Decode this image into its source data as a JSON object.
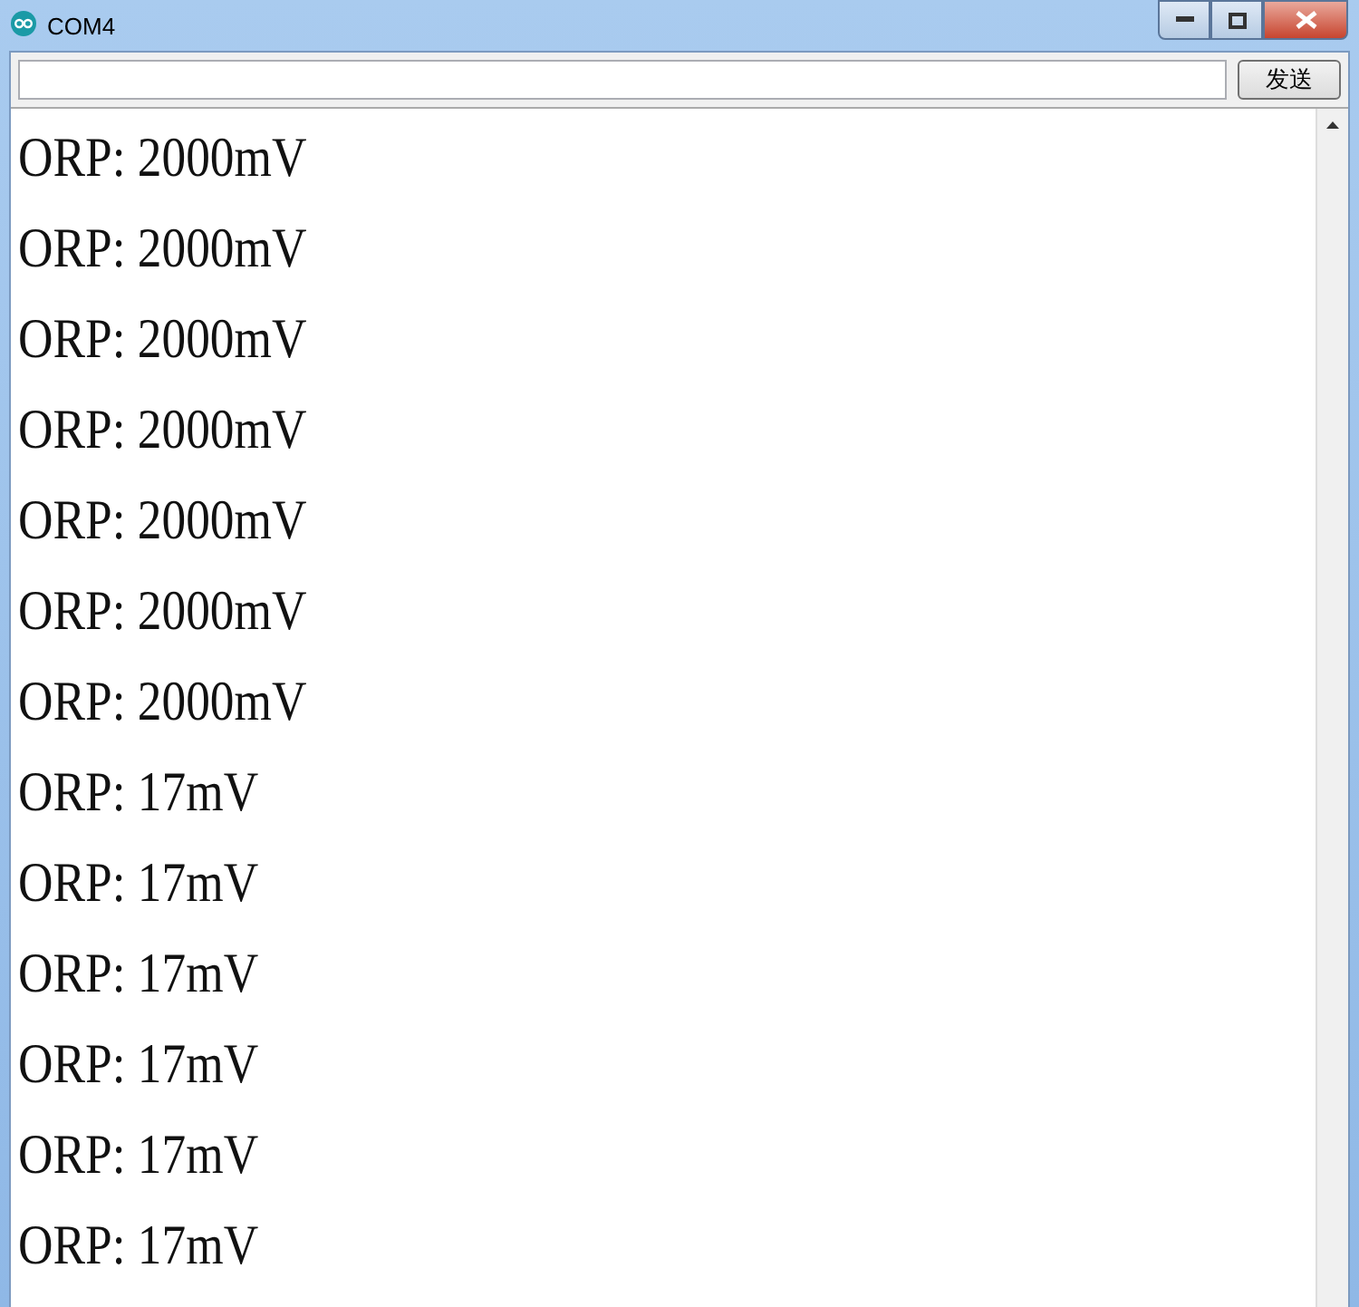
{
  "window": {
    "title": "COM4"
  },
  "send_button": {
    "label": "发送"
  },
  "output_lines": [
    "ORP: 2000mV",
    "ORP: 2000mV",
    "ORP: 2000mV",
    "ORP: 2000mV",
    "ORP: 2000mV",
    "ORP: 2000mV",
    "ORP: 2000mV",
    "ORP: 17mV",
    "ORP: 17mV",
    "ORP: 17mV",
    "ORP: 17mV",
    "ORP: 17mV",
    "ORP: 17mV"
  ]
}
